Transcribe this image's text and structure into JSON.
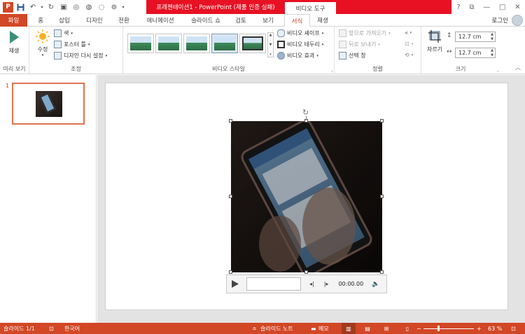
{
  "title_bar": {
    "document_title": "프레젠테이션1 - PowerPoint (제품 인증 실패)",
    "contextual_tab_group": "비디오 도구",
    "help": "?",
    "win_controls": [
      "?",
      "⧉",
      "—",
      "□",
      "✕"
    ]
  },
  "tabs": {
    "file": "파일",
    "items": [
      "홈",
      "삽입",
      "디자인",
      "전환",
      "애니메이션",
      "슬라이드 쇼",
      "검토",
      "보기"
    ],
    "format": "서식",
    "playback": "재생",
    "signin": "로그인"
  },
  "ribbon": {
    "preview": {
      "play": "재생",
      "group": "미리 보기"
    },
    "adjust": {
      "corrections": "수정",
      "color": "색",
      "poster_frame": "포스터 틀",
      "reset_design": "디자인 다시 설정",
      "group": "조정"
    },
    "video_styles": {
      "shape": "비디오 셰이프",
      "border": "비디오 테두리",
      "effects": "비디오 효과",
      "group": "비디오 스타일"
    },
    "arrange": {
      "bring_forward": "앞으로 가져오기",
      "send_backward": "뒤로 보내기",
      "selection_pane": "선택 창",
      "group": "정렬"
    },
    "size": {
      "crop": "자르기",
      "height": "12.7 cm",
      "width": "12.7 cm",
      "group": "크기"
    }
  },
  "thumbnails": {
    "slide_number": "1"
  },
  "player": {
    "time": "00:00.00"
  },
  "status": {
    "slide": "슬라이드 1/1",
    "language": "한국어",
    "notes": "슬라이드 노트",
    "comments": "메모",
    "zoom": "63 %",
    "zoom_value": 63
  },
  "colors": {
    "accent": "#d24726",
    "title_red": "#e81123"
  }
}
